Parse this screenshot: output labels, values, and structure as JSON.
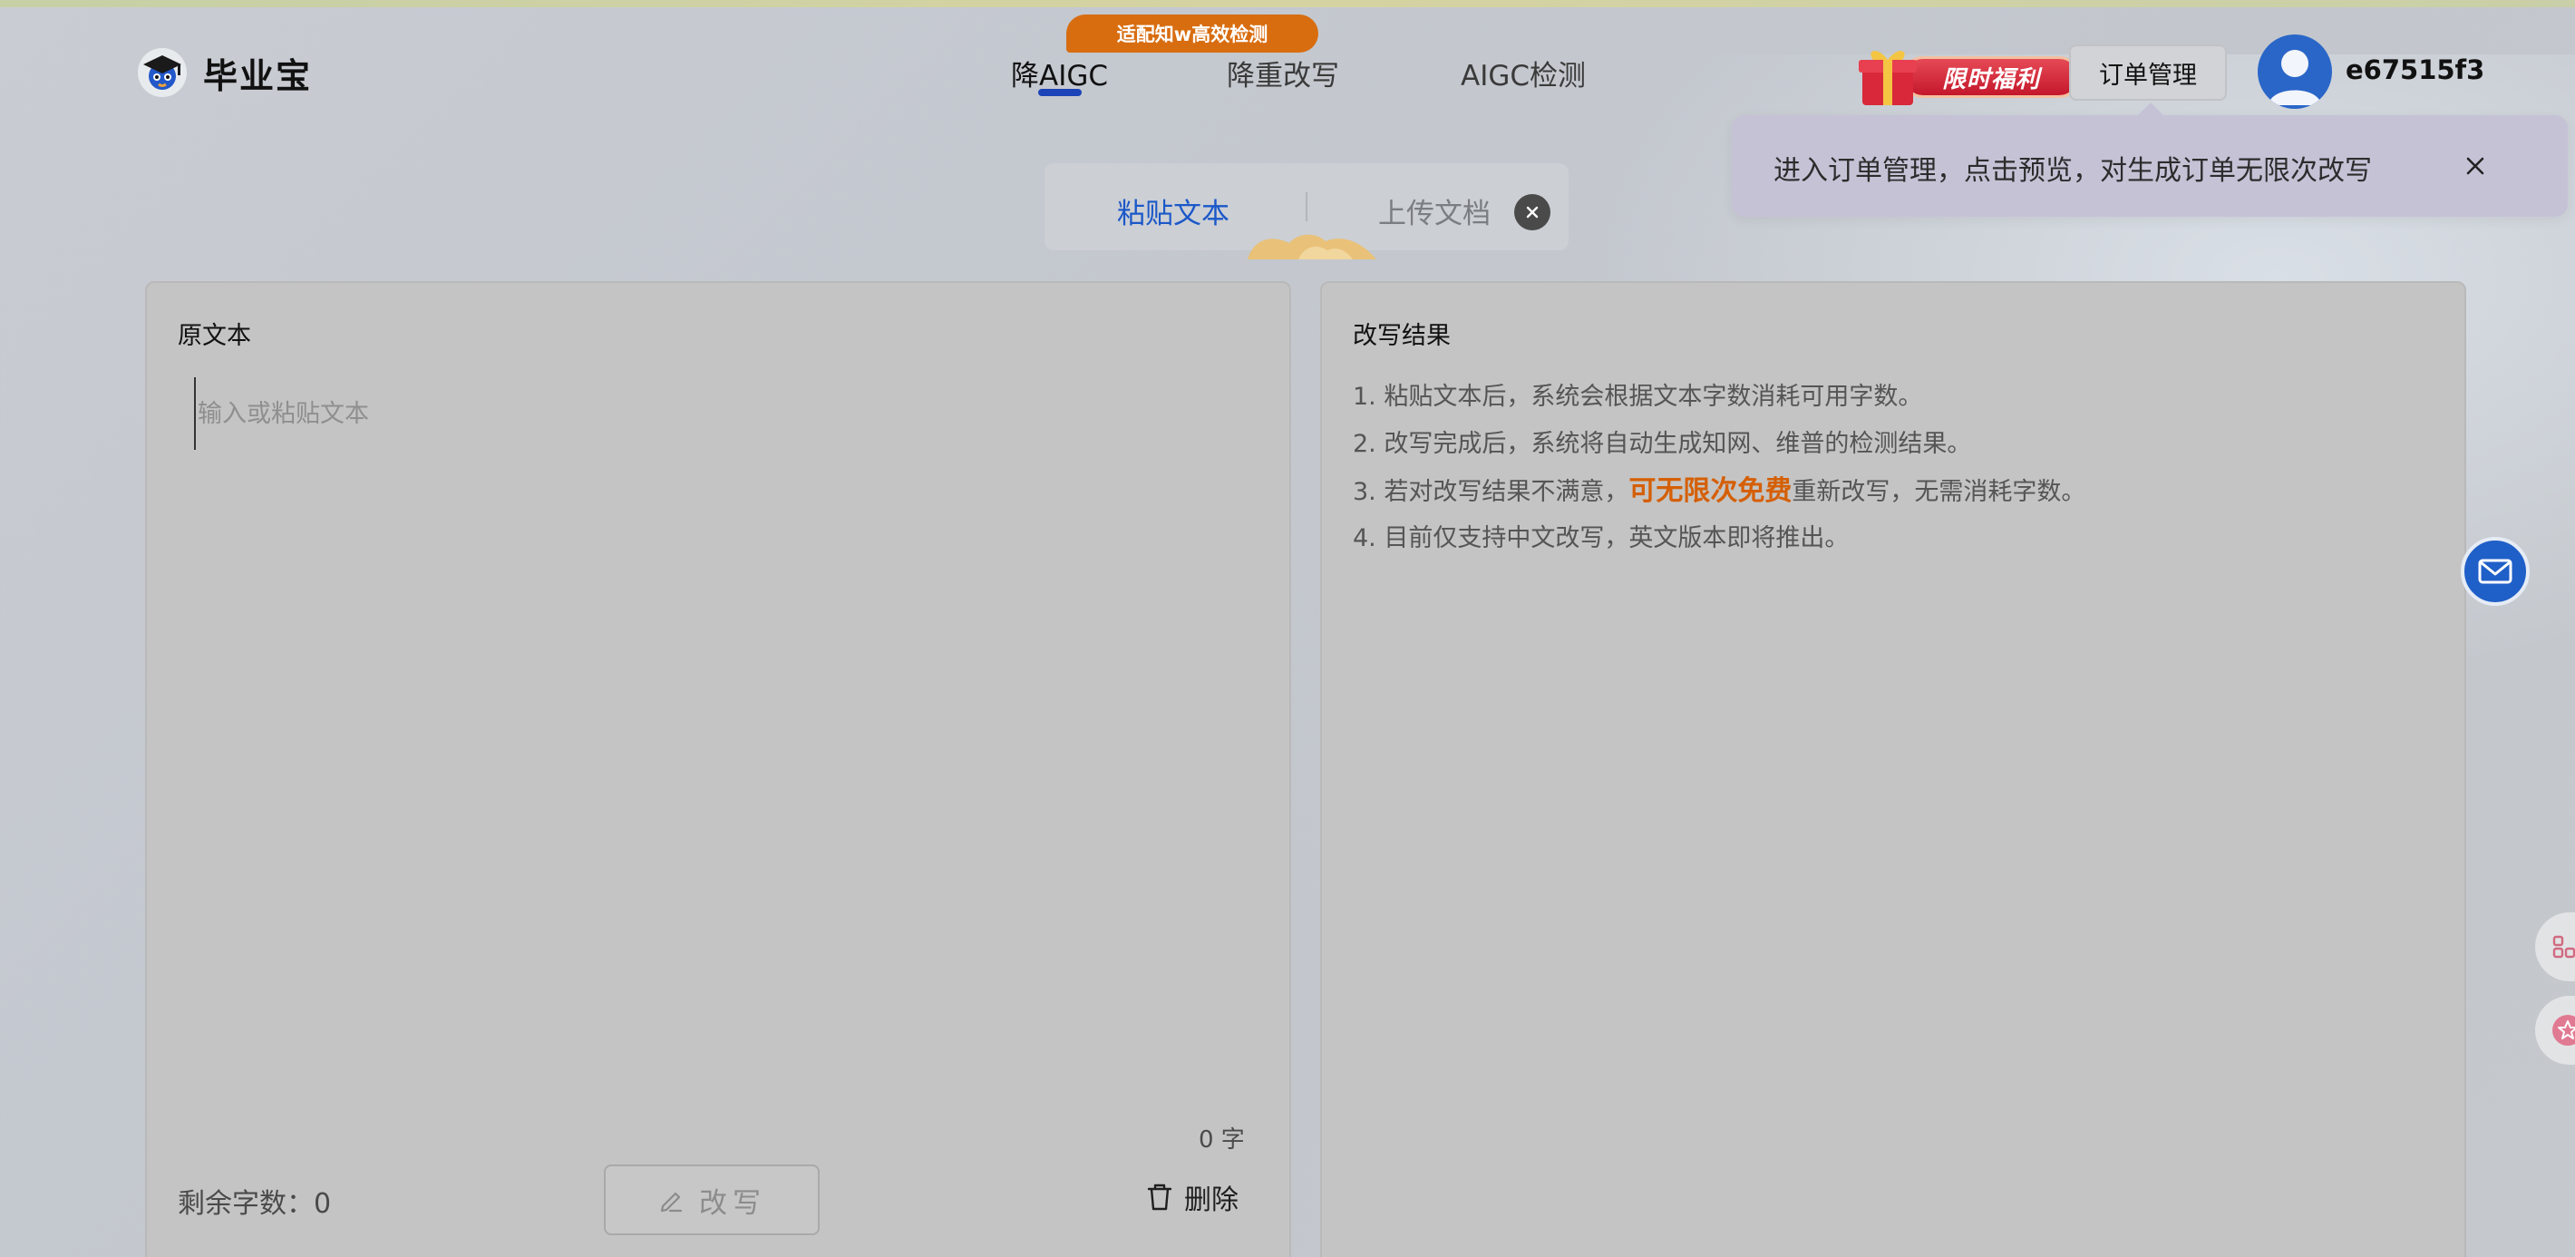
{
  "brand": {
    "name": "毕业宝"
  },
  "nav": {
    "items": [
      {
        "label": "降AIGC",
        "active": true
      },
      {
        "label": "降重改写",
        "active": false
      },
      {
        "label": "AIGC检测",
        "active": false
      }
    ],
    "badge": "适配知w高效检测"
  },
  "header": {
    "promo_label": "限时福利",
    "order_button": "订单管理",
    "username": "e67515f3"
  },
  "tooltip": {
    "text": "进入订单管理，点击预览，对生成订单无限次改写"
  },
  "input_tabs": {
    "paste": "粘贴文本",
    "upload": "上传文档"
  },
  "left_panel": {
    "title": "原文本",
    "placeholder": "输入或粘贴文本",
    "value": "",
    "char_count": "0 字",
    "remaining_label": "剩余字数：",
    "remaining_value": "0",
    "rewrite_button": "改写",
    "delete_button": "删除"
  },
  "right_panel": {
    "title": "改写结果",
    "instructions": {
      "line1": "1. 粘贴文本后，系统会根据文本字数消耗可用字数。",
      "line2": "2. 改写完成后，系统将自动生成知网、维普的检测结果。",
      "line3_pre": "3. 若对改写结果不满意，",
      "line3_highlight": "可无限次免费",
      "line3_post": "重新改写，无需消耗字数。",
      "line4": "4. 目前仅支持中文改写，英文版本即将推出。"
    }
  },
  "colors": {
    "accent_blue": "#1b58c8",
    "nav_underline": "#1c44b8",
    "badge_orange": "#d86d10",
    "highlight_orange": "#d55f05",
    "promo_red": "#c4172b"
  },
  "icons": {
    "logo": "graduation-cap-icon",
    "tooltip_close": "close-icon",
    "tab_close": "close-icon",
    "rewrite": "pencil-icon",
    "delete": "trash-icon",
    "mail": "mail-icon",
    "gift": "gift-icon"
  }
}
